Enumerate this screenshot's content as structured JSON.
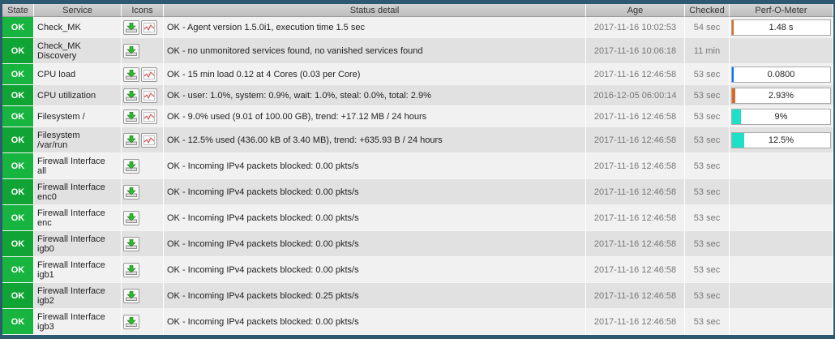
{
  "headers": {
    "state": "State",
    "service": "Service",
    "icons": "Icons",
    "detail": "Status detail",
    "age": "Age",
    "checked": "Checked",
    "perf": "Perf-O-Meter"
  },
  "colors": {
    "ok": "#17b53f",
    "perf_blue": "#0074ff",
    "perf_teal": "#1ee0c8",
    "perf_orange": "#d96a26"
  },
  "rows": [
    {
      "state": "OK",
      "service": [
        "Check_MK",
        ""
      ],
      "icons": [
        "action-icon",
        "graph-icon"
      ],
      "detail": "OK - Agent version 1.5.0i1, execution time 1.5 sec",
      "age": "2017-11-16 10:02:53",
      "checked": "54 sec",
      "perf": {
        "label": "1.48 s",
        "fraction": 0.005,
        "color": "#d96a26"
      }
    },
    {
      "state": "OK",
      "service": [
        "Check_MK",
        "Discovery"
      ],
      "icons": [
        "action-icon"
      ],
      "detail": "OK - no unmonitored services found, no vanished services found",
      "age": "2017-11-16 10:06:18",
      "checked": "11 min",
      "perf": null
    },
    {
      "state": "OK",
      "service": [
        "CPU load",
        ""
      ],
      "icons": [
        "action-icon",
        "graph-icon"
      ],
      "detail": "OK - 15 min load 0.12 at 4 Cores (0.03 per Core)",
      "age": "2017-11-16 12:46:58",
      "checked": "53 sec",
      "perf": {
        "label": "0.0800",
        "fraction": 0.012,
        "color": "#0074ff"
      }
    },
    {
      "state": "OK",
      "service": [
        "CPU utilization",
        ""
      ],
      "icons": [
        "action-icon",
        "graph-icon"
      ],
      "detail": "OK - user: 1.0%, system: 0.9%, wait: 1.0%, steal: 0.0%, total: 2.9%",
      "age": "2016-12-05 06:00:14",
      "checked": "53 sec",
      "perf": {
        "label": "2.93%",
        "fraction": 0.0293,
        "color": "#d96a26"
      }
    },
    {
      "state": "OK",
      "service": [
        "Filesystem /",
        ""
      ],
      "icons": [
        "action-icon",
        "graph-icon"
      ],
      "detail": "OK - 9.0% used (9.01 of 100.00 GB), trend: +17.12 MB / 24 hours",
      "age": "2017-11-16 12:46:58",
      "checked": "53 sec",
      "perf": {
        "label": "9%",
        "fraction": 0.09,
        "color": "#1ee0c8"
      }
    },
    {
      "state": "OK",
      "service": [
        "Filesystem",
        "/var/run"
      ],
      "icons": [
        "action-icon",
        "graph-icon"
      ],
      "detail": "OK - 12.5% used (436.00 kB of 3.40 MB), trend: +635.93 B / 24 hours",
      "age": "2017-11-16 12:46:58",
      "checked": "53 sec",
      "perf": {
        "label": "12.5%",
        "fraction": 0.125,
        "color": "#1ee0c8"
      }
    },
    {
      "state": "OK",
      "service": [
        "Firewall Interface",
        "all"
      ],
      "icons": [
        "action-icon"
      ],
      "detail": "OK - Incoming IPv4 packets blocked: 0.00 pkts/s",
      "age": "2017-11-16 12:46:58",
      "checked": "53 sec",
      "perf": null
    },
    {
      "state": "OK",
      "service": [
        "Firewall Interface",
        "enc0"
      ],
      "icons": [
        "action-icon"
      ],
      "detail": "OK - Incoming IPv4 packets blocked: 0.00 pkts/s",
      "age": "2017-11-16 12:46:58",
      "checked": "53 sec",
      "perf": null
    },
    {
      "state": "OK",
      "service": [
        "Firewall Interface",
        "enc"
      ],
      "icons": [
        "action-icon"
      ],
      "detail": "OK - Incoming IPv4 packets blocked: 0.00 pkts/s",
      "age": "2017-11-16 12:46:58",
      "checked": "53 sec",
      "perf": null
    },
    {
      "state": "OK",
      "service": [
        "Firewall Interface",
        "igb0"
      ],
      "icons": [
        "action-icon"
      ],
      "detail": "OK - Incoming IPv4 packets blocked: 0.00 pkts/s",
      "age": "2017-11-16 12:46:58",
      "checked": "53 sec",
      "perf": null
    },
    {
      "state": "OK",
      "service": [
        "Firewall Interface",
        "igb1"
      ],
      "icons": [
        "action-icon"
      ],
      "detail": "OK - Incoming IPv4 packets blocked: 0.00 pkts/s",
      "age": "2017-11-16 12:46:58",
      "checked": "53 sec",
      "perf": null
    },
    {
      "state": "OK",
      "service": [
        "Firewall Interface",
        "igb2"
      ],
      "icons": [
        "action-icon"
      ],
      "detail": "OK - Incoming IPv4 packets blocked: 0.25 pkts/s",
      "age": "2017-11-16 12:46:58",
      "checked": "53 sec",
      "perf": null
    },
    {
      "state": "OK",
      "service": [
        "Firewall Interface",
        "igb3"
      ],
      "icons": [
        "action-icon"
      ],
      "detail": "OK - Incoming IPv4 packets blocked: 0.00 pkts/s",
      "age": "2017-11-16 12:46:58",
      "checked": "53 sec",
      "perf": null
    }
  ]
}
